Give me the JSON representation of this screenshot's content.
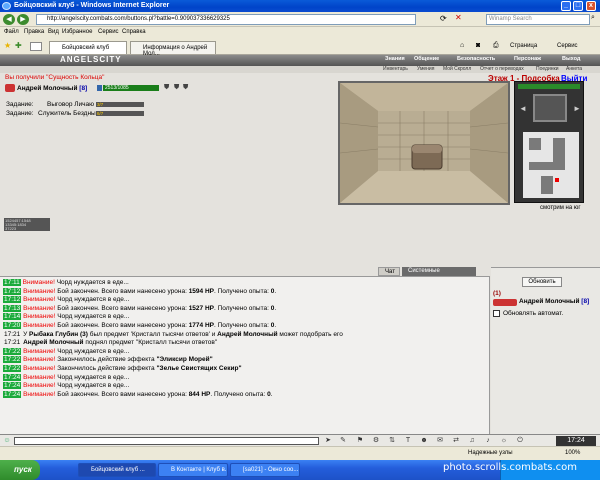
{
  "window": {
    "title": "Бойцовский клуб - Windows Internet Explorer",
    "minimize": "_",
    "maximize": "□",
    "close": "x"
  },
  "addressbar": {
    "url": "http://angelscity.combats.com/buttons.pl?battle=0.909037336629325",
    "search_placeholder": "Winamp Search"
  },
  "menu": [
    "Файл",
    "Правка",
    "Вид",
    "Избранное",
    "Сервис",
    "Справка"
  ],
  "tabs": [
    {
      "label": "Бойцовский клуб"
    },
    {
      "label": "Информация о Андрей Мол..."
    }
  ],
  "toolbar_right": {
    "page": "Страница",
    "service": "Сервис"
  },
  "game": {
    "logo": "ANGELSCITY",
    "topmenu": [
      "Знания",
      "Общение",
      "Безопасность",
      "Персонаж",
      "Выход"
    ],
    "submenu": [
      "Инвентарь",
      "Умения",
      "Мой Скролл",
      "Отчет о переводах",
      "Поединки",
      "Анкета"
    ],
    "warning": "Вы получили \"Сущность Кольца\"",
    "floor": "Этаж 1 - Подсобка",
    "exit": "Выйти",
    "character": {
      "name": "Андрей Молочный",
      "level": "[8]",
      "hp": "2513/1085"
    },
    "tasks": [
      {
        "label": "Задание:",
        "name": "Выговор Личаю",
        "value": "3/7"
      },
      {
        "label": "Задание:",
        "name": "Служитель Бездны",
        "value": "6/7"
      }
    ],
    "look": "смотрим на юг",
    "statbox": [
      "1524457:1548",
      "13345:1834",
      "37223"
    ]
  },
  "chat": {
    "tabs": [
      "Чат",
      "Системные сообщения"
    ],
    "lines": [
      {
        "time": "17:11",
        "style": "green",
        "prefix": "Внимание!",
        "text": "Чорд нуждается в еде..."
      },
      {
        "time": "17:12",
        "style": "green",
        "prefix": "Внимание!",
        "text": "Бой закончен. Всего вами нанесено урона: ",
        "bold": "1594 HP",
        "suffix": ". Получено опыта: ",
        "bold2": "0",
        "end": "."
      },
      {
        "time": "17:12",
        "style": "green",
        "prefix": "Внимание!",
        "text": "Чорд нуждается в еде..."
      },
      {
        "time": "17:13",
        "style": "green",
        "prefix": "Внимание!",
        "text": "Бой закончен. Всего вами нанесено урона: ",
        "bold": "1527 HP",
        "suffix": ". Получено опыта: ",
        "bold2": "0",
        "end": "."
      },
      {
        "time": "17:14",
        "style": "green",
        "prefix": "Внимание!",
        "text": "Чорд нуждается в еде..."
      },
      {
        "time": "17:20",
        "style": "green",
        "prefix": "Внимание!",
        "text": "Бой закончен. Всего вами нанесено урона: ",
        "bold": "1774 HP",
        "suffix": ". Получено опыта: ",
        "bold2": "0",
        "end": "."
      },
      {
        "time": "17:21",
        "style": "plain",
        "prefix": "",
        "text": "У ",
        "bold": "Рыбака Глубин (3)",
        "suffix": " был предмет 'Кристалл тысячи ответов' и ",
        "bold2": "Андрей Молочный",
        "end": " может подобрать его"
      },
      {
        "time": "17:21",
        "style": "plain",
        "prefix": "",
        "text": "",
        "bold": "Андрей Молочный",
        "suffix": " поднял предмет \"Кристалл тысячи ответов\"",
        "bold2": "",
        "end": ""
      },
      {
        "time": "17:22",
        "style": "green",
        "prefix": "Внимание!",
        "text": "Чорд нуждается в еде..."
      },
      {
        "time": "17:22",
        "style": "green",
        "prefix": "Внимание!",
        "text": "Закончилось действие эффекта ",
        "bold": "\"Эликсир Морей\"",
        "suffix": "",
        "bold2": "",
        "end": ""
      },
      {
        "time": "17:22",
        "style": "green",
        "prefix": "Внимание!",
        "text": "Закончилось действие эффекта ",
        "bold": "\"Зелье Свистящих Секир\"",
        "suffix": "",
        "bold2": "",
        "end": ""
      },
      {
        "time": "17:24",
        "style": "green",
        "prefix": "Внимание!",
        "text": "Чорд нуждается в еде..."
      },
      {
        "time": "17:24",
        "style": "green",
        "prefix": "Внимание!",
        "text": "Чорд нуждается в еде..."
      },
      {
        "time": "17:24",
        "style": "green",
        "prefix": "Внимание!",
        "text": "Бой закончен. Всего вами нанесено урона: ",
        "bold": "844 HP",
        "suffix": ". Получено опыта: ",
        "bold2": "0",
        "end": "."
      }
    ]
  },
  "right_panel": {
    "refresh": "Обновить",
    "count": "(1)",
    "user": "Андрей Молочный",
    "user_level": "[8]",
    "auto_refresh": "Обновлять автомат."
  },
  "input_bar": {
    "clock": "17:24"
  },
  "statusbar": {
    "zone": "Надежные узлы",
    "zoom": "100%"
  },
  "taskbar": {
    "start": "пуск",
    "buttons": [
      "Бойцовский клуб ...",
      "В Контакте | Клуб в...",
      "[sa021] - Окно соо..."
    ]
  },
  "watermark": "photo.scrolls.combats.com",
  "colors": {
    "accent_green": "#1aaa3a",
    "warning_red": "#e00000",
    "title_blue": "#0a5ad8"
  }
}
